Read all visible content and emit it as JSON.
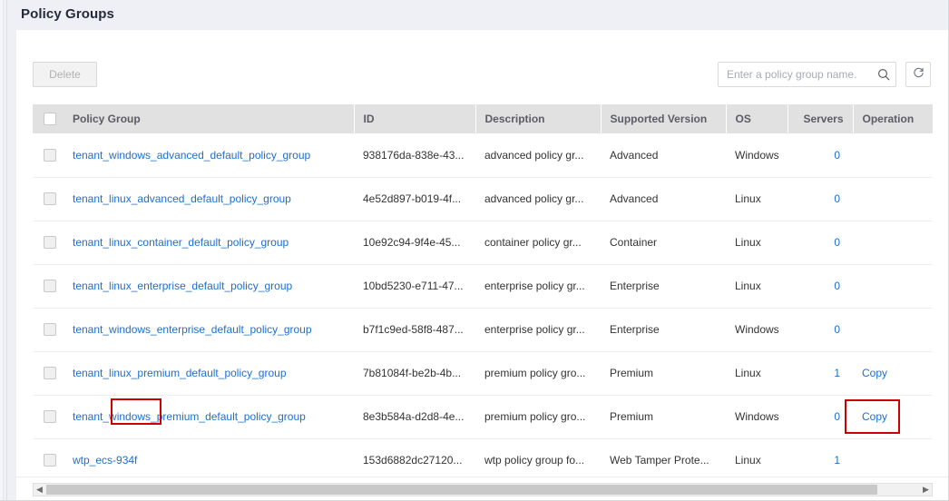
{
  "page": {
    "title": "Policy Groups"
  },
  "toolbar": {
    "delete_label": "Delete",
    "search_placeholder": "Enter a policy group name.",
    "search_value": "",
    "search_icon": "search-icon",
    "refresh_icon": "refresh-icon"
  },
  "table": {
    "columns": [
      {
        "key": "check",
        "label": ""
      },
      {
        "key": "name",
        "label": "Policy Group"
      },
      {
        "key": "id",
        "label": "ID"
      },
      {
        "key": "description",
        "label": "Description"
      },
      {
        "key": "version",
        "label": "Supported Version"
      },
      {
        "key": "os",
        "label": "OS"
      },
      {
        "key": "servers",
        "label": "Servers"
      },
      {
        "key": "operation",
        "label": "Operation"
      }
    ],
    "rows": [
      {
        "name": "tenant_windows_advanced_default_policy_group",
        "id": "938176da-838e-43...",
        "description": "advanced policy gr...",
        "version": "Advanced",
        "os": "Windows",
        "servers": "0",
        "operation": ""
      },
      {
        "name": "tenant_linux_advanced_default_policy_group",
        "id": "4e52d897-b019-4f...",
        "description": "advanced policy gr...",
        "version": "Advanced",
        "os": "Linux",
        "servers": "0",
        "operation": ""
      },
      {
        "name": "tenant_linux_container_default_policy_group",
        "id": "10e92c94-9f4e-45...",
        "description": "container policy gr...",
        "version": "Container",
        "os": "Linux",
        "servers": "0",
        "operation": ""
      },
      {
        "name": "tenant_linux_enterprise_default_policy_group",
        "id": "10bd5230-e711-47...",
        "description": "enterprise policy gr...",
        "version": "Enterprise",
        "os": "Linux",
        "servers": "0",
        "operation": ""
      },
      {
        "name": "tenant_windows_enterprise_default_policy_group",
        "id": "b7f1c9ed-58f8-487...",
        "description": "enterprise policy gr...",
        "version": "Enterprise",
        "os": "Windows",
        "servers": "0",
        "operation": ""
      },
      {
        "name": "tenant_linux_premium_default_policy_group",
        "id": "7b81084f-be2b-4b...",
        "description": "premium policy gro...",
        "version": "Premium",
        "os": "Linux",
        "servers": "1",
        "operation": "Copy"
      },
      {
        "name": "tenant_windows_premium_default_policy_group",
        "id": "8e3b584a-d2d8-4e...",
        "description": "premium policy gro...",
        "version": "Premium",
        "os": "Windows",
        "servers": "0",
        "operation": "Copy"
      },
      {
        "name": "wtp_ecs-934f",
        "id": "153d6882dc27120...",
        "description": "wtp policy group fo...",
        "version": "Web Tamper Prote...",
        "os": "Linux",
        "servers": "1",
        "operation": ""
      }
    ]
  },
  "scrollbar": {
    "left_arrow": "◀",
    "right_arrow": "▶",
    "thumb_percent": 95
  },
  "annotations": [
    {
      "name": "highlight-windows-token",
      "color": "#cc0000"
    },
    {
      "name": "highlight-copy-button",
      "color": "#cc0000"
    }
  ],
  "colors": {
    "link": "#1e6fcc",
    "header_bg": "#e1e1e1",
    "page_bg": "#eef0f5",
    "annotation": "#cc0000"
  }
}
